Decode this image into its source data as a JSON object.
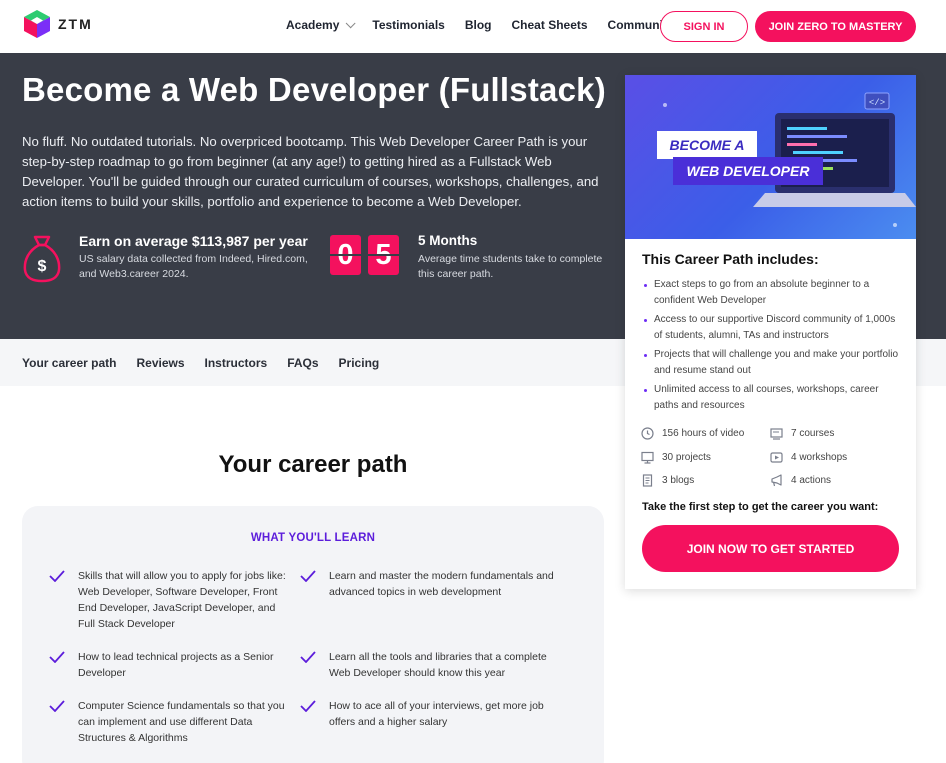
{
  "nav": {
    "logo_text": "ZTM",
    "links": [
      "Academy",
      "Testimonials",
      "Blog",
      "Cheat Sheets",
      "Community"
    ],
    "signin_label": "SIGN IN",
    "join_label": "JOIN ZERO TO MASTERY"
  },
  "hero": {
    "title": "Become a Web Developer (Fullstack)",
    "description": "No fluff. No outdated tutorials. No overpriced bootcamp. This Web Developer Career Path is your step-by-step roadmap to go from beginner (at any age!) to getting hired as a Fullstack Web Developer. You'll be guided through our curated curriculum of courses, workshops, challenges, and action items to build your skills, portfolio and experience to become a Web Developer.",
    "salary_head": "Earn on average $113,987 per year",
    "salary_sub": "US salary data collected from Indeed, Hired.com, and Web3.career 2024.",
    "digits": [
      "0",
      "5"
    ],
    "months_head": "5 Months",
    "months_sub": "Average time students take to complete this career path."
  },
  "subnav": {
    "items": [
      "Your career path",
      "Reviews",
      "Instructors",
      "FAQs",
      "Pricing"
    ]
  },
  "main": {
    "section_title": "Your career path",
    "learn_head": "WHAT YOU'LL LEARN",
    "learn_items": [
      "Skills that will allow you to apply for jobs like: Web Developer, Software Developer, Front End Developer, JavaScript Developer, and Full Stack Developer",
      "Learn and master the modern fundamentals and advanced topics in web development",
      "How to lead technical projects as a Senior Developer",
      "Learn all the tools and libraries that a complete Web Developer should know this year",
      "Computer Science fundamentals so that you can implement and use different Data Structures & Algorithms",
      "How to ace all of your interviews, get more job offers and a higher salary"
    ]
  },
  "card": {
    "banner_line1": "BECOME A",
    "banner_line2": "WEB DEVELOPER",
    "title": "This Career Path includes:",
    "includes": [
      "Exact steps to go from an absolute beginner to a confident Web Developer",
      "Access to our supportive Discord community of 1,000s of students, alumni, TAs and instructors",
      "Projects that will challenge you and make your portfolio and resume stand out",
      "Unlimited access to all courses, workshops, career paths and resources"
    ],
    "stats": {
      "video": "156 hours of video",
      "courses": "7 courses",
      "projects": "30 projects",
      "workshops": "4 workshops",
      "blogs": "3 blogs",
      "actions": "4 actions"
    },
    "cta_text": "Take the first step to get the career you want:",
    "cta_button": "JOIN NOW TO GET STARTED"
  },
  "colors": {
    "accent": "#f4115e",
    "hero_bg": "#393d47",
    "purple": "#5c1ddb"
  }
}
